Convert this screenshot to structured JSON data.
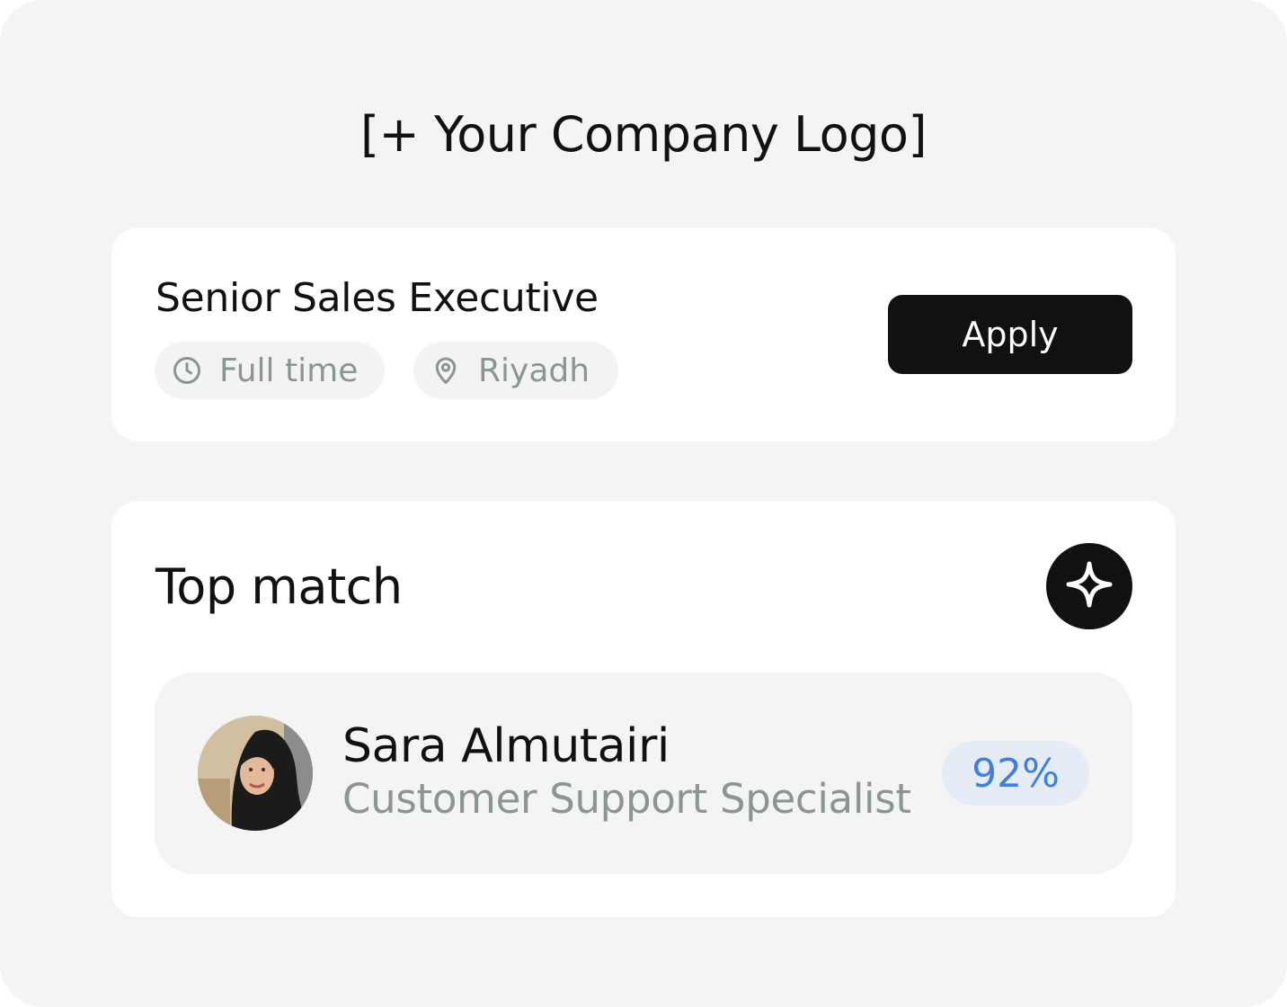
{
  "header": {
    "logo_placeholder": "[+ Your Company Logo]"
  },
  "job": {
    "title": "Senior Sales Executive",
    "employment_type": "Full time",
    "employment_type_icon": "clock-icon",
    "location": "Riyadh",
    "location_icon": "map-pin-icon",
    "apply_label": "Apply"
  },
  "top_match": {
    "section_title": "Top match",
    "action_icon": "sparkle-icon",
    "candidate": {
      "name": "Sara Almutairi",
      "role": "Customer Support Specialist",
      "match_score": "92%",
      "avatar": "avatar-photo"
    }
  },
  "colors": {
    "background": "#f4f4f4",
    "card": "#ffffff",
    "primary": "#111111",
    "muted_text": "#8a9696",
    "score_text": "#3f7fe3",
    "score_bg": "#e6ecf6"
  }
}
